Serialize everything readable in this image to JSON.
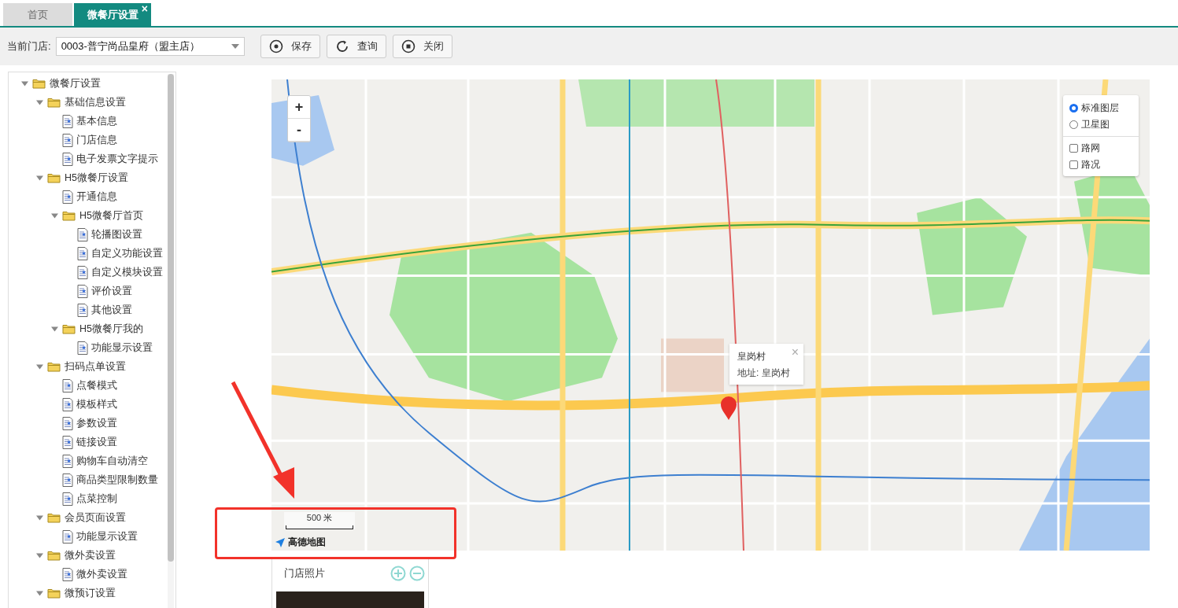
{
  "tabs": [
    {
      "label": "首页",
      "selected": false
    },
    {
      "label": "微餐厅设置",
      "selected": true,
      "close": "×"
    }
  ],
  "toolbar": {
    "store_label": "当前门店:",
    "store_value": "0003-普宁尚品皇府（盟主店）",
    "buttons": [
      {
        "kind": "save",
        "label": "保存"
      },
      {
        "kind": "refresh",
        "label": "查询"
      },
      {
        "kind": "close",
        "label": "关闭"
      }
    ]
  },
  "tree": [
    {
      "kind": "folder",
      "label": "微餐厅设置",
      "expanded": true,
      "children": [
        {
          "kind": "folder",
          "label": "基础信息设置",
          "expanded": true,
          "children": [
            {
              "kind": "page",
              "label": "基本信息"
            },
            {
              "kind": "page",
              "label": "门店信息"
            },
            {
              "kind": "page",
              "label": "电子发票文字提示"
            }
          ]
        },
        {
          "kind": "folder",
          "label": "H5微餐厅设置",
          "expanded": true,
          "children": [
            {
              "kind": "page",
              "label": "开通信息"
            },
            {
              "kind": "folder",
              "label": "H5微餐厅首页",
              "expanded": true,
              "children": [
                {
                  "kind": "page",
                  "label": "轮播图设置"
                },
                {
                  "kind": "page",
                  "label": "自定义功能设置"
                },
                {
                  "kind": "page",
                  "label": "自定义模块设置"
                },
                {
                  "kind": "page",
                  "label": "评价设置"
                },
                {
                  "kind": "page",
                  "label": "其他设置"
                }
              ]
            },
            {
              "kind": "folder",
              "label": "H5微餐厅我的",
              "expanded": true,
              "children": [
                {
                  "kind": "page",
                  "label": "功能显示设置"
                }
              ]
            }
          ]
        },
        {
          "kind": "folder",
          "label": "扫码点单设置",
          "expanded": true,
          "children": [
            {
              "kind": "page",
              "label": "点餐模式"
            },
            {
              "kind": "page",
              "label": "模板样式"
            },
            {
              "kind": "page",
              "label": "参数设置"
            },
            {
              "kind": "page",
              "label": "链接设置"
            },
            {
              "kind": "page",
              "label": "购物车自动清空"
            },
            {
              "kind": "page",
              "label": "商品类型限制数量"
            },
            {
              "kind": "page",
              "label": "点菜控制"
            }
          ]
        },
        {
          "kind": "folder",
          "label": "会员页面设置",
          "expanded": true,
          "children": [
            {
              "kind": "page",
              "label": "功能显示设置"
            }
          ]
        },
        {
          "kind": "folder",
          "label": "微外卖设置",
          "expanded": true,
          "children": [
            {
              "kind": "page",
              "label": "微外卖设置"
            }
          ]
        },
        {
          "kind": "folder",
          "label": "微预订设置",
          "expanded": true
        }
      ]
    }
  ],
  "map": {
    "zoom_in": "+",
    "zoom_out": "-",
    "layers": [
      {
        "label": "标准图层",
        "selected": true
      },
      {
        "label": "卫星图",
        "selected": false
      }
    ],
    "overlays": [
      {
        "label": "路网",
        "checked": false
      },
      {
        "label": "路况",
        "checked": false
      }
    ],
    "popup": {
      "title": "皇岗村",
      "address": "地址: 皇岗村",
      "close": "×"
    },
    "scale": "500 米",
    "logo": "高德地图"
  },
  "photos": {
    "title": "门店照片"
  }
}
